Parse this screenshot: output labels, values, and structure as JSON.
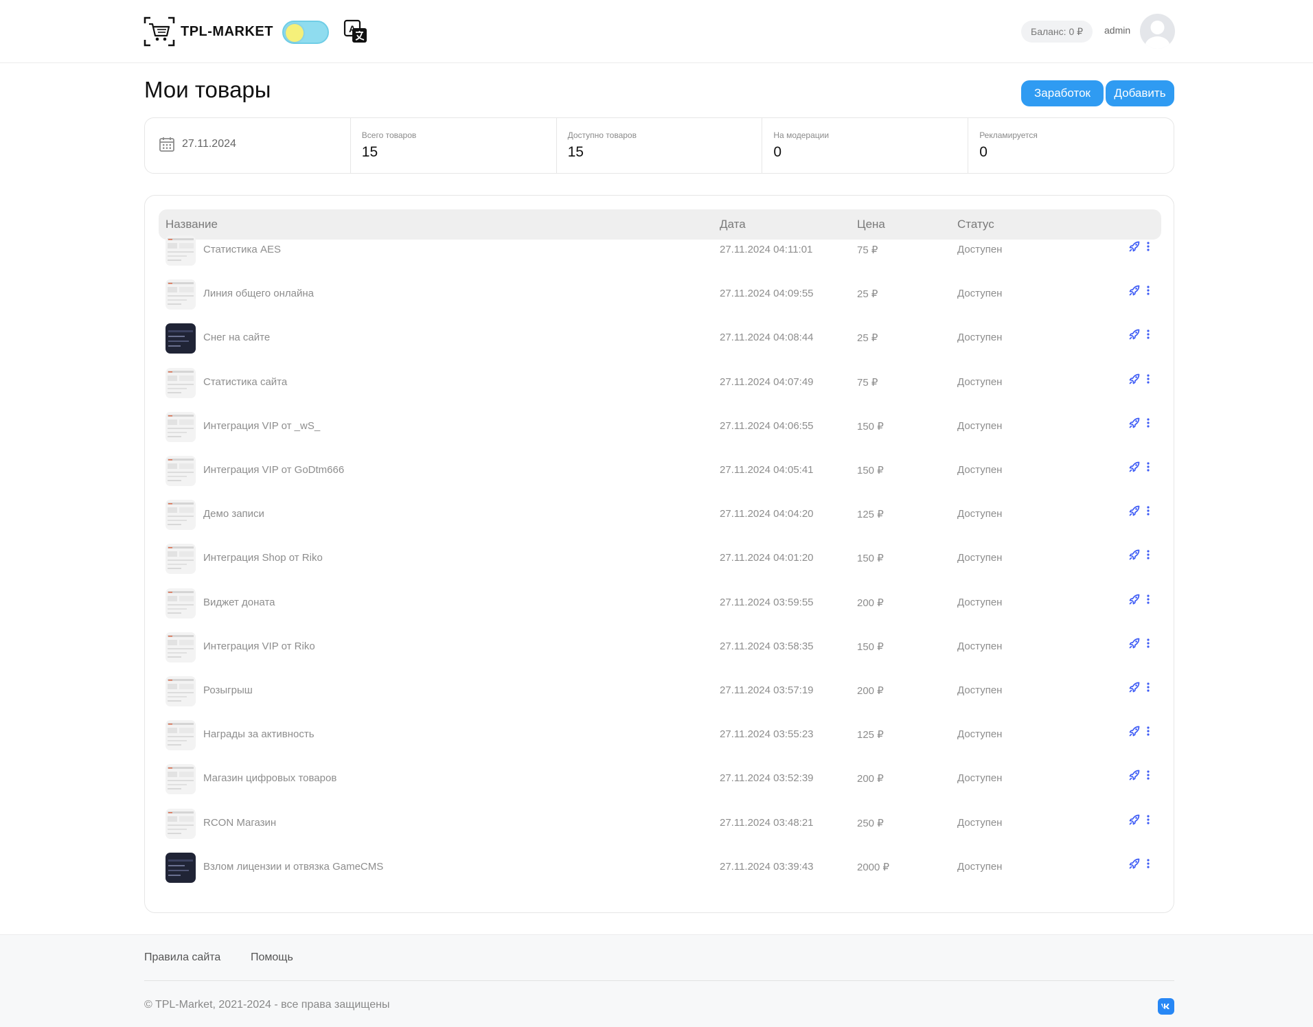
{
  "header": {
    "logo_text": "TPL-MARKET",
    "balance": "Баланс: 0 ₽",
    "username": "admin"
  },
  "page": {
    "title": "Мои товары",
    "earnings_button": "Заработок",
    "add_button": "Добавить"
  },
  "stats": {
    "date": "27.11.2024",
    "items": [
      {
        "label": "Всего товаров",
        "value": "15"
      },
      {
        "label": "Доступно товаров",
        "value": "15"
      },
      {
        "label": "На модерации",
        "value": "0"
      },
      {
        "label": "Рекламируется",
        "value": "0"
      }
    ]
  },
  "table": {
    "columns": [
      "Название",
      "Дата",
      "Цена",
      "Статус"
    ],
    "rows": [
      {
        "name": "Статистика AES",
        "date": "27.11.2024 04:11:01",
        "price": "75 ₽",
        "status": "Доступен",
        "thumb": "light"
      },
      {
        "name": "Линия общего онлайна",
        "date": "27.11.2024 04:09:55",
        "price": "25 ₽",
        "status": "Доступен",
        "thumb": "light"
      },
      {
        "name": "Снег на сайте",
        "date": "27.11.2024 04:08:44",
        "price": "25 ₽",
        "status": "Доступен",
        "thumb": "dark"
      },
      {
        "name": "Статистика сайта",
        "date": "27.11.2024 04:07:49",
        "price": "75 ₽",
        "status": "Доступен",
        "thumb": "light"
      },
      {
        "name": "Интеграция VIP от _wS_",
        "date": "27.11.2024 04:06:55",
        "price": "150 ₽",
        "status": "Доступен",
        "thumb": "light"
      },
      {
        "name": "Интеграция VIP от GoDtm666",
        "date": "27.11.2024 04:05:41",
        "price": "150 ₽",
        "status": "Доступен",
        "thumb": "light"
      },
      {
        "name": "Демо записи",
        "date": "27.11.2024 04:04:20",
        "price": "125 ₽",
        "status": "Доступен",
        "thumb": "light"
      },
      {
        "name": "Интеграция Shop от Riko",
        "date": "27.11.2024 04:01:20",
        "price": "150 ₽",
        "status": "Доступен",
        "thumb": "light"
      },
      {
        "name": "Виджет доната",
        "date": "27.11.2024 03:59:55",
        "price": "200 ₽",
        "status": "Доступен",
        "thumb": "light"
      },
      {
        "name": "Интеграция VIP от Riko",
        "date": "27.11.2024 03:58:35",
        "price": "150 ₽",
        "status": "Доступен",
        "thumb": "light"
      },
      {
        "name": "Розыгрыш",
        "date": "27.11.2024 03:57:19",
        "price": "200 ₽",
        "status": "Доступен",
        "thumb": "light"
      },
      {
        "name": "Награды за активность",
        "date": "27.11.2024 03:55:23",
        "price": "125 ₽",
        "status": "Доступен",
        "thumb": "light"
      },
      {
        "name": "Магазин цифровых товаров",
        "date": "27.11.2024 03:52:39",
        "price": "200 ₽",
        "status": "Доступен",
        "thumb": "light"
      },
      {
        "name": "RCON Магазин",
        "date": "27.11.2024 03:48:21",
        "price": "250 ₽",
        "status": "Доступен",
        "thumb": "light"
      },
      {
        "name": "Взлом лицензии и отвязка GameCMS",
        "date": "27.11.2024 03:39:43",
        "price": "2000 ₽",
        "status": "Доступен",
        "thumb": "dark"
      }
    ]
  },
  "footer": {
    "rules_link": "Правила сайта",
    "help_link": "Помощь",
    "copyright": "© TPL-Market, 2021-2024 - все права защищены"
  },
  "icons": {
    "logo": "cart-scan-icon",
    "theme": "theme-toggle",
    "translate": "translate-icon",
    "date": "calendar-icon",
    "promote": "rocket-icon",
    "menu": "more-vertical-icon",
    "social": "vk-icon"
  },
  "colors": {
    "accent": "#2f9bf2",
    "promote_icon": "#3d5bf5",
    "toggle_track": "#8fdcef",
    "toggle_knob": "#f5f07a",
    "vk": "#2787f5"
  }
}
